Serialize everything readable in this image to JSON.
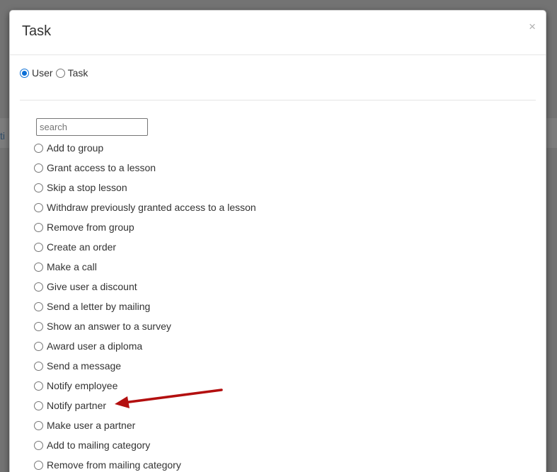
{
  "background": {
    "stub_text": "ti"
  },
  "modal": {
    "title": "Task",
    "close_glyph": "×",
    "type_options": [
      {
        "label": "User",
        "selected": true
      },
      {
        "label": "Task",
        "selected": false
      }
    ],
    "search": {
      "value": "",
      "placeholder": "search"
    },
    "actions": [
      {
        "label": "Add to group"
      },
      {
        "label": "Grant access to a lesson"
      },
      {
        "label": "Skip a stop lesson"
      },
      {
        "label": "Withdraw previously granted access to a lesson"
      },
      {
        "label": "Remove from group"
      },
      {
        "label": "Create an order"
      },
      {
        "label": "Make a call"
      },
      {
        "label": "Give user a discount"
      },
      {
        "label": "Send a letter by mailing"
      },
      {
        "label": "Show an answer to a survey"
      },
      {
        "label": "Award user a diploma"
      },
      {
        "label": "Send a message"
      },
      {
        "label": "Notify employee"
      },
      {
        "label": "Notify partner"
      },
      {
        "label": "Make user a partner"
      },
      {
        "label": "Add to mailing category"
      },
      {
        "label": "Remove from mailing category"
      }
    ]
  },
  "annotation": {
    "color": "#b30f0f",
    "icon": "red-arrow-icon"
  }
}
